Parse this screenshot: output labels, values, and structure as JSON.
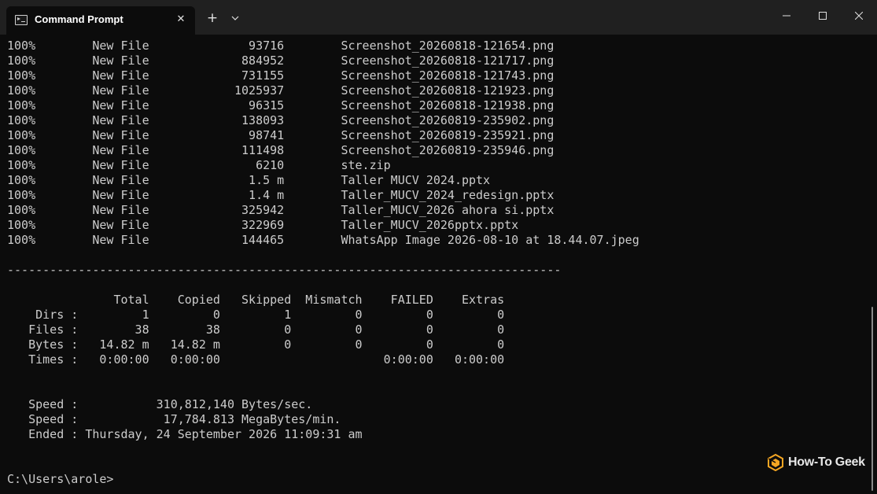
{
  "window": {
    "tab_title": "Command Prompt",
    "tab_close_glyph": "✕",
    "new_tab_glyph": "+",
    "icons": {
      "tab_icon": "terminal-icon",
      "close": "close-icon",
      "new_tab": "plus-icon",
      "dropdown": "chevron-down-icon",
      "minimize": "minimize-icon",
      "maximize": "maximize-icon",
      "window_close": "close-icon"
    }
  },
  "terminal": {
    "lines": [
      "100%        New File              93716        Screenshot_20260818-121654.png",
      "100%        New File             884952        Screenshot_20260818-121717.png",
      "100%        New File             731155        Screenshot_20260818-121743.png",
      "100%        New File            1025937        Screenshot_20260818-121923.png",
      "100%        New File              96315        Screenshot_20260818-121938.png",
      "100%        New File             138093        Screenshot_20260819-235902.png",
      "100%        New File              98741        Screenshot_20260819-235921.png",
      "100%        New File             111498        Screenshot_20260819-235946.png",
      "100%        New File               6210        ste.zip",
      "100%        New File              1.5 m        Taller MUCV 2024.pptx",
      "100%        New File              1.4 m        Taller_MUCV_2024_redesign.pptx",
      "100%        New File             325942        Taller_MUCV_2026 ahora si.pptx",
      "100%        New File             322969        Taller_MUCV_2026pptx.pptx",
      "100%        New File             144465        WhatsApp Image 2026-08-10 at 18.44.07.jpeg",
      "",
      "------------------------------------------------------------------------------",
      "",
      "               Total    Copied   Skipped  Mismatch    FAILED    Extras",
      "    Dirs :         1         0         1         0         0         0",
      "   Files :        38        38         0         0         0         0",
      "   Bytes :   14.82 m   14.82 m         0         0         0         0",
      "   Times :   0:00:00   0:00:00                       0:00:00   0:00:00",
      "",
      "",
      "   Speed :           310,812,140 Bytes/sec.",
      "   Speed :            17,784.813 MegaBytes/min.",
      "   Ended : Thursday, 24 September 2026 11:09:31 am",
      "",
      "",
      "C:\\Users\\arole>"
    ]
  },
  "watermark": {
    "text": "How-To Geek",
    "icon": "how-to-geek-logo-icon",
    "color": "#f5a623"
  },
  "colors": {
    "background": "#0c0c0c",
    "titlebar": "#202020",
    "foreground": "#cccccc"
  }
}
